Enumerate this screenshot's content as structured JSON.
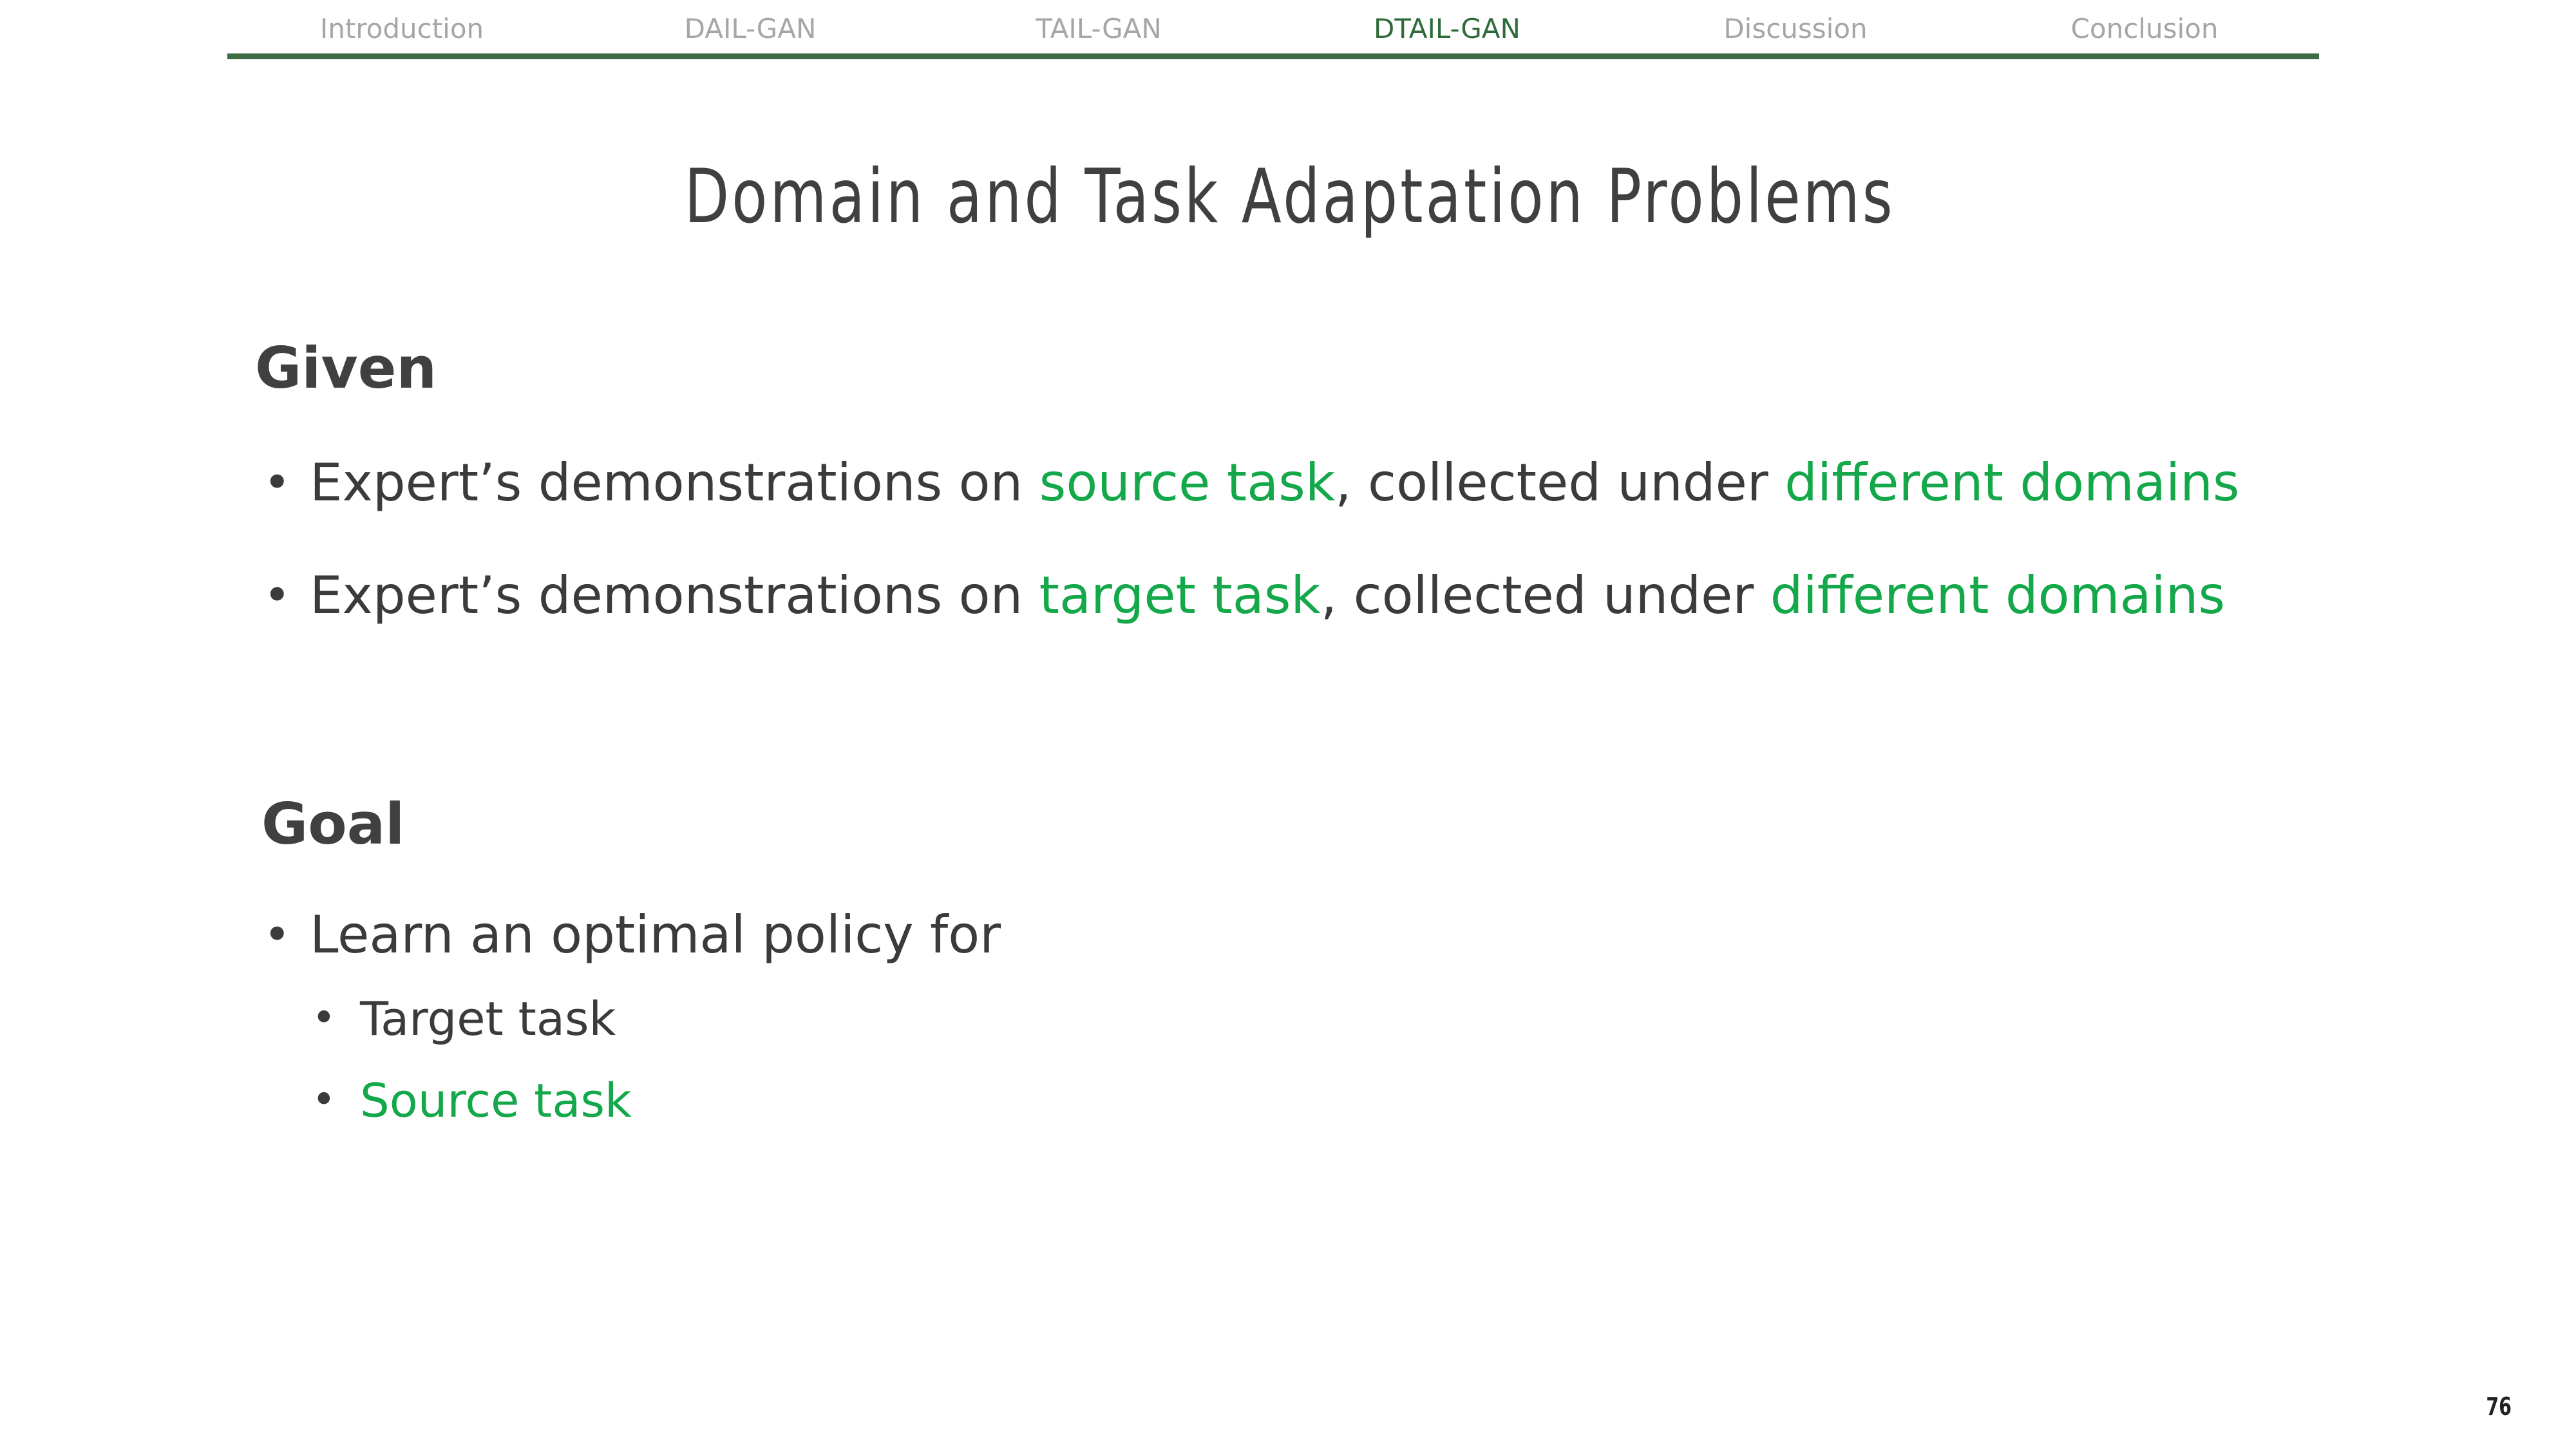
{
  "nav": {
    "tabs": [
      {
        "label": "Introduction",
        "active": false
      },
      {
        "label": "DAIL-GAN",
        "active": false
      },
      {
        "label": "TAIL-GAN",
        "active": false
      },
      {
        "label": "DTAIL-GAN",
        "active": true
      },
      {
        "label": "Discussion",
        "active": false
      },
      {
        "label": "Conclusion",
        "active": false
      }
    ],
    "rule_color": "#3e6d45",
    "active_color": "#2f6b3a",
    "inactive_color": "#a6a6a6"
  },
  "title": "Domain and Task Adaptation Problems",
  "given": {
    "heading": "Given",
    "bullets": [
      {
        "pre": "Expert’s demonstrations on ",
        "hl1": "source task",
        "mid": ", collected under ",
        "hl2": "different domains"
      },
      {
        "pre": "Expert’s demonstrations on ",
        "hl1": "target task",
        "mid": ", collected under ",
        "hl2": "different domains"
      }
    ]
  },
  "goal": {
    "heading": "Goal",
    "bullet": "Learn an optimal policy for",
    "sub_bullets": [
      {
        "text": "Target task",
        "highlight": false
      },
      {
        "text": "Source task",
        "highlight": true
      }
    ]
  },
  "page_number": "76",
  "colors": {
    "highlight": "#14a84a",
    "text": "#3b3b3b",
    "heading": "#404040"
  }
}
